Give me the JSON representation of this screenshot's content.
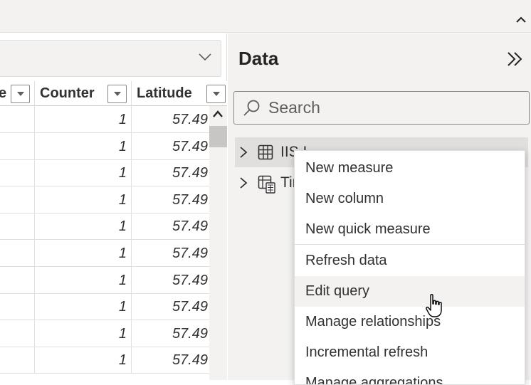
{
  "topbar": {
    "collapse_icon": "chevron-up-icon"
  },
  "grid": {
    "filter_chevron_icon": "chevron-down-icon",
    "columns": [
      {
        "label": "e"
      },
      {
        "label": "Counter"
      },
      {
        "label": "Latitude"
      }
    ],
    "rows": [
      {
        "counter": "1",
        "latitude": "57.49"
      },
      {
        "counter": "1",
        "latitude": "57.49"
      },
      {
        "counter": "1",
        "latitude": "57.49"
      },
      {
        "counter": "1",
        "latitude": "57.49"
      },
      {
        "counter": "1",
        "latitude": "57.49"
      },
      {
        "counter": "1",
        "latitude": "57.49"
      },
      {
        "counter": "1",
        "latitude": "57.49"
      },
      {
        "counter": "1",
        "latitude": "57.49"
      },
      {
        "counter": "1",
        "latitude": "57.49"
      },
      {
        "counter": "1",
        "latitude": "57.49"
      }
    ]
  },
  "data_pane": {
    "title": "Data",
    "expand_icon": "double-chevron-right-icon",
    "search": {
      "placeholder": "Search",
      "icon": "search-icon"
    },
    "tables": [
      {
        "label": "IIS I",
        "icon": "table-icon"
      },
      {
        "label": "Tir",
        "icon": "calculated-table-icon"
      }
    ]
  },
  "context_menu": {
    "items": [
      {
        "label": "New measure"
      },
      {
        "label": "New column"
      },
      {
        "label": "New quick measure"
      },
      {
        "label": "Refresh data"
      },
      {
        "label": "Edit query"
      },
      {
        "label": "Manage relationships"
      },
      {
        "label": "Incremental refresh"
      },
      {
        "label": "Manage aggregations"
      }
    ],
    "hovered": "Edit query"
  },
  "colors": {
    "pane_bg": "#f3f2f1",
    "selected_bg": "#e1dfdd",
    "border": "#8a8886",
    "text": "#252423"
  }
}
